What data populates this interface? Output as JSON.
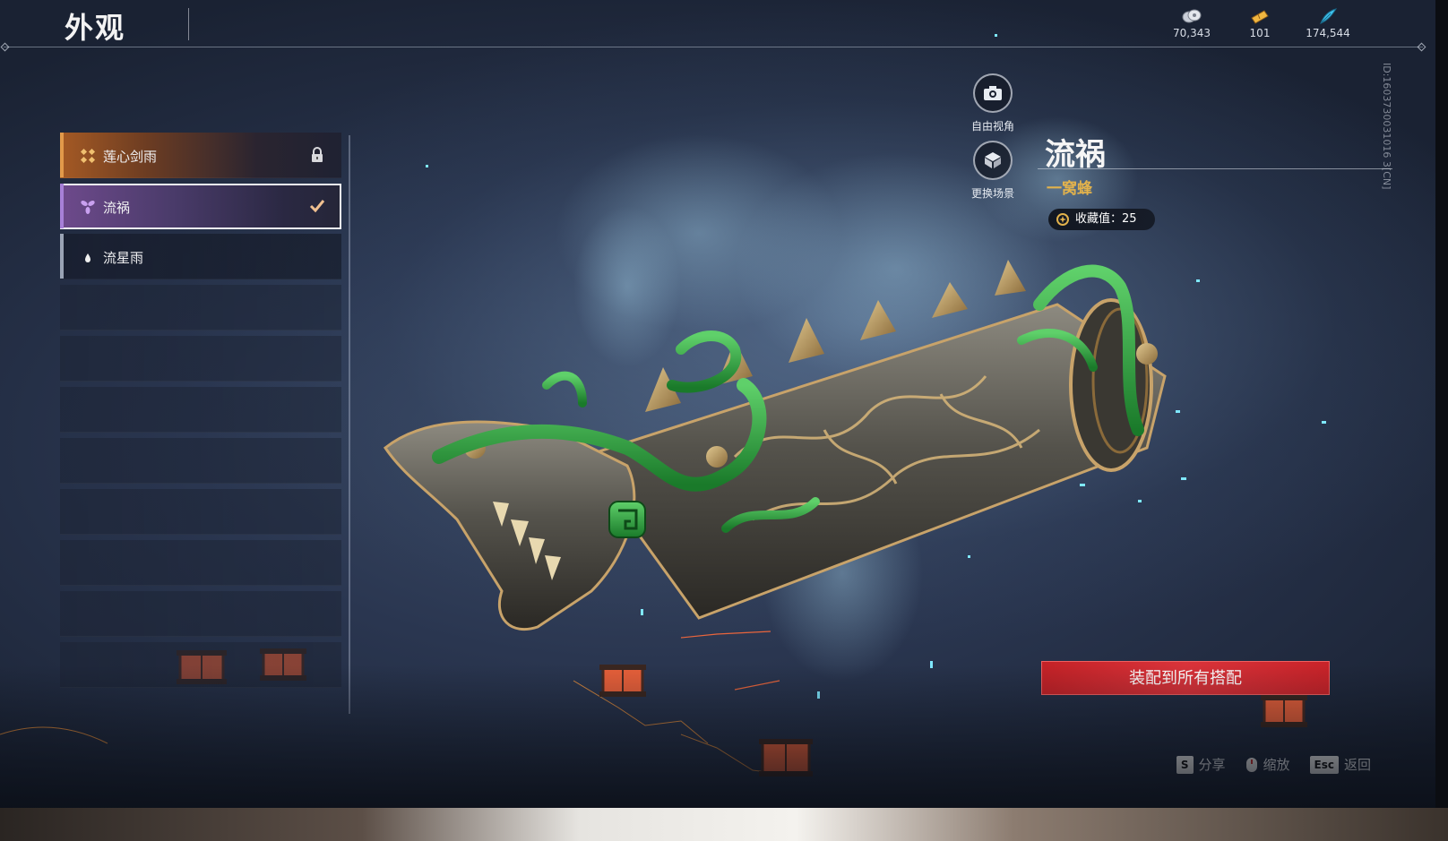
{
  "header": {
    "title": "外观"
  },
  "currencies": [
    {
      "icon": "coin-stack-icon",
      "value": "70,343"
    },
    {
      "icon": "gold-ticket-icon",
      "value": "101"
    },
    {
      "icon": "blue-feather-icon",
      "value": "174,544"
    }
  ],
  "skins": [
    {
      "name": "莲心剑雨",
      "state": "locked",
      "icon": "lotus-cross-icon",
      "accent": "#e29a4a"
    },
    {
      "name": "流祸",
      "state": "selected",
      "icon": "purple-flower-icon",
      "accent": "#a780d8"
    },
    {
      "name": "流星雨",
      "state": "normal",
      "icon": "white-drop-icon",
      "accent": "#9aa3b4"
    }
  ],
  "tools": [
    {
      "label": "自由视角",
      "icon": "camera-icon"
    },
    {
      "label": "更换场景",
      "icon": "scene-cube-icon"
    }
  ],
  "detail": {
    "name": "流祸",
    "subtitle": "一窝蜂",
    "collection": "收藏值：25",
    "id_text": "ID:1603730031016 3[CN]"
  },
  "equip_button": "装配到所有搭配",
  "hints": [
    {
      "key": "S",
      "label": "分享"
    },
    {
      "key": "mouse",
      "label": "缩放"
    },
    {
      "key": "Esc",
      "label": "返回"
    }
  ],
  "colors": {
    "equip": "#d9333a",
    "subtitle": "#e2b24c",
    "selected_accent": "#a780d8"
  }
}
